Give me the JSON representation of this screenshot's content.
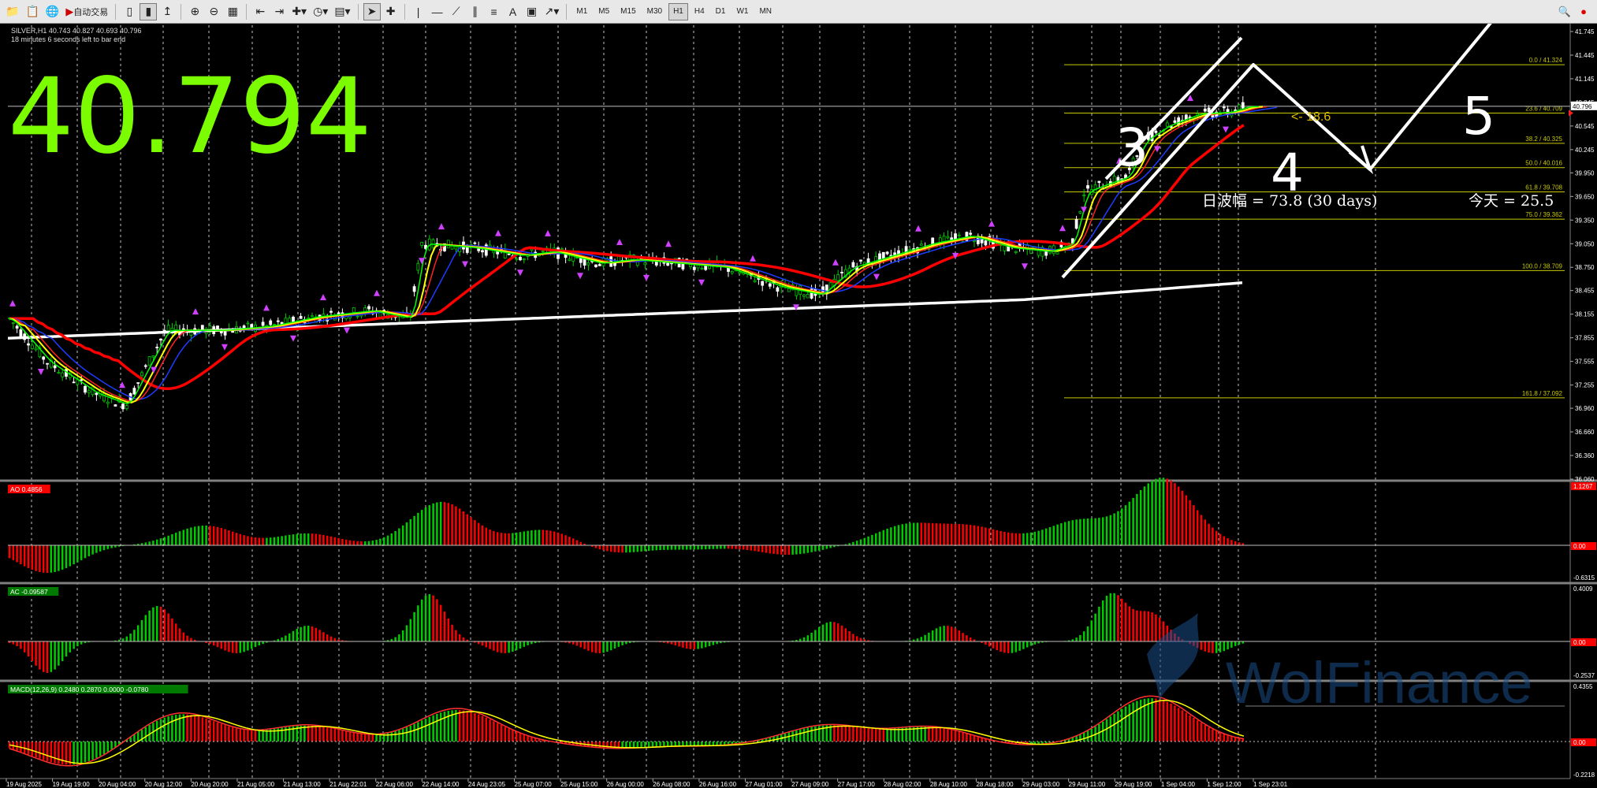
{
  "toolbar": {
    "auto_trading_label": "自动交易",
    "timeframes": [
      "M1",
      "M5",
      "M15",
      "M30",
      "H1",
      "H4",
      "D1",
      "W1",
      "MN"
    ],
    "active_timeframe": "H1"
  },
  "chart": {
    "symbol_info": "SILVER,H1  40.743 40.827 40.693 40.796",
    "timer": "18 minutes 6 seconds left to bar end",
    "big_price": "40.794",
    "current_price": "40.796",
    "wave_annotation": "日波幅 = 73.8  (30 days)",
    "today_annotation": "今天 = 25.5",
    "pip_label": "<- 18.6",
    "wave_numbers": [
      "3",
      "4",
      "5"
    ],
    "watermark": "WolFinance",
    "price_axis": [
      "41.745",
      "41.445",
      "41.145",
      "40.845",
      "40.545",
      "40.245",
      "39.950",
      "39.650",
      "39.350",
      "39.050",
      "38.750",
      "38.455",
      "38.155",
      "37.855",
      "37.555",
      "37.255",
      "36.960",
      "36.660",
      "36.360",
      "36.060"
    ],
    "fib_levels": [
      {
        "label": "0.0 / 41.324",
        "price": 41.324
      },
      {
        "label": "23.6 / 40.709",
        "price": 40.709
      },
      {
        "label": "38.2 / 40.325",
        "price": 40.325
      },
      {
        "label": "50.0 / 40.016",
        "price": 40.016
      },
      {
        "label": "61.8 / 39.708",
        "price": 39.708
      },
      {
        "label": "75.0 / 39.362",
        "price": 39.362
      },
      {
        "label": "100.0 / 38.709",
        "price": 38.709
      },
      {
        "label": "161.8 / 37.092",
        "price": 37.092
      }
    ],
    "time_axis": [
      "19 Aug 2025",
      "19 Aug 19:00",
      "20 Aug 04:00",
      "20 Aug 12:00",
      "20 Aug 20:00",
      "21 Aug 05:00",
      "21 Aug 13:00",
      "21 Aug 22:01",
      "22 Aug 06:00",
      "22 Aug 14:00",
      "24 Aug 23:05",
      "25 Aug 07:00",
      "25 Aug 15:00",
      "26 Aug 00:00",
      "26 Aug 08:00",
      "26 Aug 16:00",
      "27 Aug 01:00",
      "27 Aug 09:00",
      "27 Aug 17:00",
      "28 Aug 02:00",
      "28 Aug 10:00",
      "28 Aug 18:00",
      "29 Aug 03:00",
      "29 Aug 11:00",
      "29 Aug 19:00",
      "1 Sep 04:00",
      "1 Sep 12:00",
      "1 Sep 23:01"
    ]
  },
  "ao": {
    "label": "AO 0.4856",
    "axis": [
      "1.1267",
      "0.00",
      "-0.6315"
    ]
  },
  "ac": {
    "label": "AC -0.09587",
    "axis": [
      "0.4009",
      "0.00",
      "-0.2537"
    ]
  },
  "macd": {
    "label": "MACD(12,26,9) 0.2480 0.2870 0.0000 -0.0780",
    "axis": [
      "0.4355",
      "0.00",
      "-0.2218"
    ]
  },
  "colors": {
    "bull": "#00cc00",
    "bear": "#ff0000",
    "price_big": "#7cfc00",
    "fib": "#c8c800",
    "ma_green": "#00ff00",
    "ma_yellow": "#ffff00",
    "ma_red_fast": "#ff2020",
    "ma_blue": "#1e3cff",
    "ma_red_slow": "#ff0000",
    "ma_white": "#ffffff",
    "fractal": "#d040ff"
  }
}
